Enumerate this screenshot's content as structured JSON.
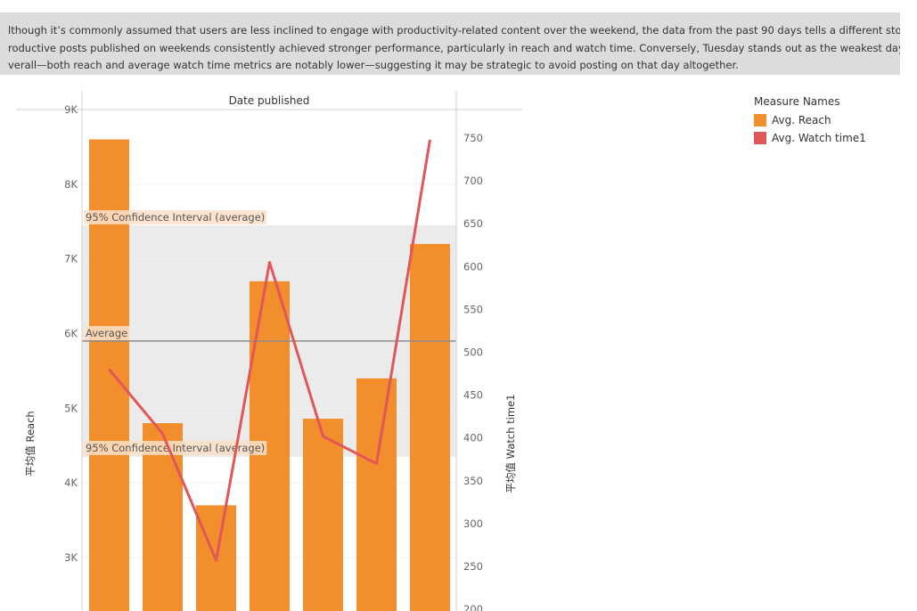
{
  "caption": {
    "lines": [
      "lthough it’s commonly assumed that users are less inclined to engage with productivity-related content over the weekend, the data from the past 90 days tells a different story.",
      "roductive posts published on weekends consistently achieved stronger performance, particularly in reach and watch time. Conversely, Tuesday stands out as the weakest day",
      "verall—both reach and average watch time metrics are notably lower—suggesting it may be strategic to avoid posting on that day altogether."
    ]
  },
  "legend": {
    "title": "Measure Names",
    "items": [
      {
        "label": "Avg. Reach",
        "color": "#f28e2b"
      },
      {
        "label": "Avg. Watch time1",
        "color": "#e15759"
      }
    ]
  },
  "chart_data": {
    "type": "bar",
    "header": "Date published",
    "ylabel_left": "平均值 Reach",
    "ylabel_right": "平均值 Watch time1",
    "left_axis": {
      "ticks": [
        3000,
        4000,
        5000,
        6000,
        7000,
        8000,
        9000
      ],
      "tick_labels": [
        "3K",
        "4K",
        "5K",
        "6K",
        "7K",
        "8K",
        "9K"
      ]
    },
    "right_axis": {
      "ticks": [
        200,
        250,
        300,
        350,
        400,
        450,
        500,
        550,
        600,
        650,
        700,
        750
      ],
      "tick_labels": [
        "200",
        "250",
        "300",
        "350",
        "400",
        "450",
        "500",
        "550",
        "600",
        "650",
        "700",
        "750"
      ]
    },
    "bars": {
      "name": "Avg. Reach",
      "color": "#f28e2b",
      "values": [
        8600,
        4800,
        3700,
        6700,
        4860,
        5400,
        7200
      ]
    },
    "line": {
      "name": "Avg. Watch time1",
      "color": "#e15759",
      "values": [
        480,
        405,
        257,
        605,
        402,
        370,
        748
      ]
    },
    "reference": {
      "average": 5900,
      "average_label": "Average",
      "ci_upper": 7450,
      "ci_lower": 4350,
      "ci_label": "95% Confidence Interval (average)"
    },
    "grid": true
  }
}
